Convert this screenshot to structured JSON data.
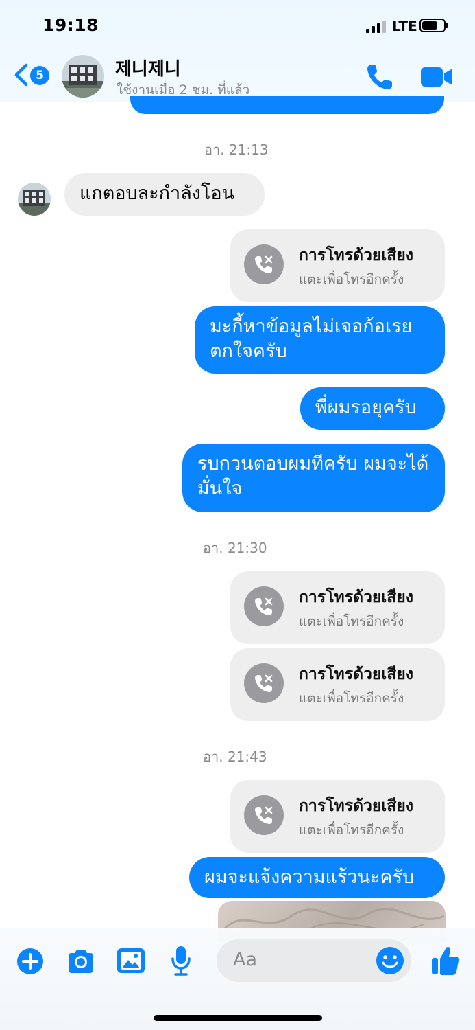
{
  "status_bar": {
    "time": "19:18",
    "network": "LTE"
  },
  "header": {
    "back_badge": "5",
    "contact_name": "제니제니",
    "contact_status": "ใช้งานเมื่อ 2 ชม. ที่แล้ว",
    "icons": [
      "chevron-left-icon",
      "phone-icon",
      "video-icon"
    ]
  },
  "timestamps": [
    "อา. 21:13",
    "อา. 21:30",
    "อา. 21:43"
  ],
  "messages": {
    "incoming_1": "แกตอบละกำลังโอน",
    "out_1": "มะกี้หาข้อมูลไม่เจอก้อเรยตกใจครับ",
    "out_2": "พี่ผมรอยุครับ",
    "out_3": "รบกวนตอบผมทีครับ ผมจะได้มั่นใจ",
    "out_4": "ผมจะแจ้งความแร้วนะครับ"
  },
  "call_card": {
    "title": "การโทรด้วยเสียง",
    "subtitle": "แตะเพื่อโทรอีกครั้ง"
  },
  "composer": {
    "placeholder": "Aa",
    "icons": [
      "plus-icon",
      "camera-icon",
      "gallery-icon",
      "microphone-icon",
      "emoji-icon",
      "thumbs-up-icon"
    ]
  },
  "colors": {
    "accent": "#0a84ff",
    "incoming_bubble": "#eeeeee",
    "muted_text": "#8a8a8e"
  }
}
